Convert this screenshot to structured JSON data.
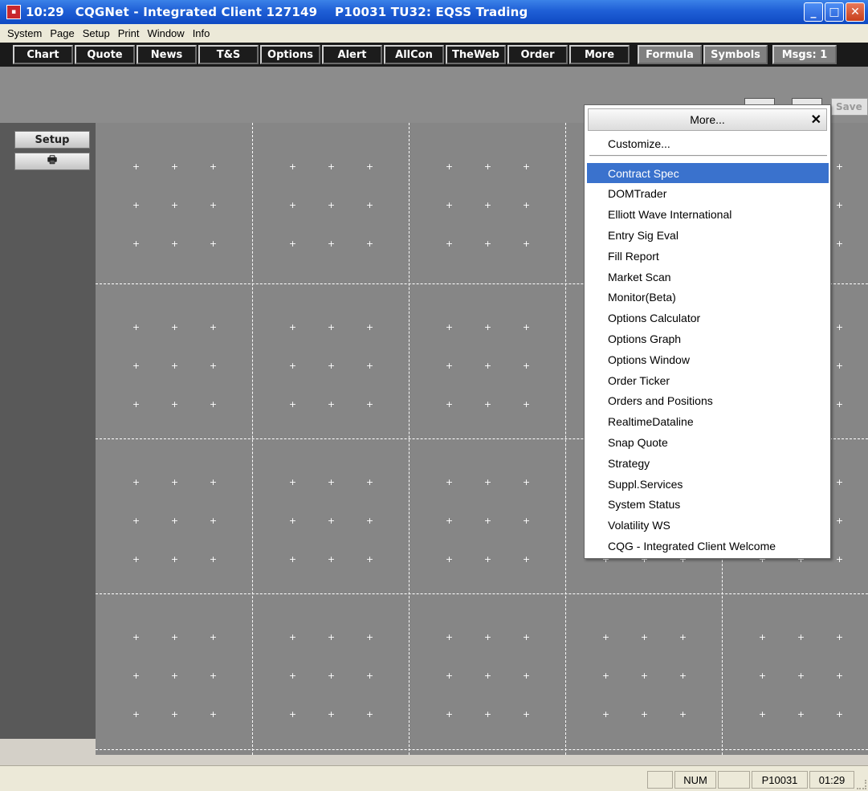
{
  "titlebar": {
    "time": "10:29",
    "title": "CQGNet - Integrated Client 127149    P10031 TU32: EQSS Trading",
    "icon": "cqg-app-icon"
  },
  "menubar": [
    "System",
    "Page",
    "Setup",
    "Print",
    "Window",
    "Info"
  ],
  "toolbar": {
    "buttons": [
      "Chart",
      "Quote",
      "News",
      "T&S",
      "Options",
      "Alert",
      "AllCon",
      "TheWeb",
      "Order",
      "More"
    ],
    "right_buttons": [
      "Formula",
      "Symbols",
      "Msgs: 1"
    ]
  },
  "save_label": "Save",
  "left_panel": {
    "setup_label": "Setup",
    "print_icon": "printer-icon",
    "print_glyph": "🖶"
  },
  "dropdown": {
    "header": "More...",
    "close_glyph": "✕",
    "customize": "Customize...",
    "selected_index": 0,
    "items": [
      "Contract Spec",
      "DOMTrader",
      "Elliott Wave International",
      "Entry Sig Eval",
      "Fill Report",
      "Market Scan",
      "Monitor(Beta)",
      "Options Calculator",
      "Options Graph",
      "Options Window",
      "Order Ticker",
      "Orders and Positions",
      "RealtimeDataline",
      "Snap Quote",
      "Strategy",
      "Suppl.Services",
      "System Status",
      "Volatility WS",
      "CQG - Integrated Client Welcome"
    ]
  },
  "statusbar": {
    "num": "NUM",
    "account": "P10031",
    "time": "01:29"
  },
  "colors": {
    "titlebar": "#1f5fd6",
    "grid_bg": "#868686",
    "selected": "#3a72cd"
  }
}
